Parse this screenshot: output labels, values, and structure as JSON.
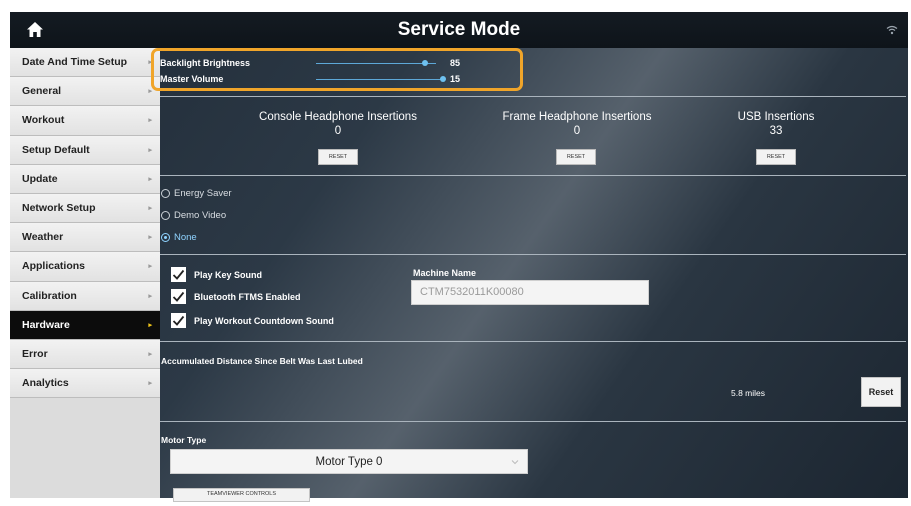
{
  "header": {
    "title": "Service Mode",
    "home_icon": "home-icon",
    "wifi_icon": "wifi-icon"
  },
  "sidebar": {
    "items": [
      {
        "label": "Date And Time Setup"
      },
      {
        "label": "General"
      },
      {
        "label": "Workout"
      },
      {
        "label": "Setup Default"
      },
      {
        "label": "Update"
      },
      {
        "label": "Network Setup"
      },
      {
        "label": "Weather"
      },
      {
        "label": "Applications"
      },
      {
        "label": "Calibration"
      },
      {
        "label": "Hardware",
        "active": true
      },
      {
        "label": "Error"
      },
      {
        "label": "Analytics"
      }
    ]
  },
  "sliders": {
    "brightness": {
      "label": "Backlight Brightness",
      "value": "85",
      "fraction": 0.85
    },
    "volume": {
      "label": "Master Volume",
      "value": "15",
      "fraction": 0.99
    }
  },
  "counters": {
    "console": {
      "label": "Console Headphone Insertions",
      "value": "0",
      "reset": "RESET"
    },
    "frame": {
      "label": "Frame Headphone Insertions",
      "value": "0",
      "reset": "RESET"
    },
    "usb": {
      "label": "USB Insertions",
      "value": "33",
      "reset": "RESET"
    }
  },
  "modes": {
    "energy": "Energy Saver",
    "demo": "Demo Video",
    "none": "None",
    "selected": "None"
  },
  "checks": {
    "key_sound": "Play Key Sound",
    "ftms": "Bluetooth FTMS Enabled",
    "countdown": "Play Workout Countdown Sound"
  },
  "machine": {
    "label": "Machine Name",
    "value": "CTM7532011K00080"
  },
  "belt": {
    "label": "Accumulated Distance Since Belt Was Last Lubed",
    "distance": "5.8 miles",
    "reset": "Reset"
  },
  "motor": {
    "label": "Motor Type",
    "value": "Motor Type 0"
  },
  "teamviewer": {
    "label": "TEAMVIEWER CONTROLS"
  },
  "colors": {
    "accent": "#f0a52a",
    "slider": "#5da8d8",
    "active_chevron": "#f0c419",
    "radio_selected": "#8fd3ff"
  }
}
